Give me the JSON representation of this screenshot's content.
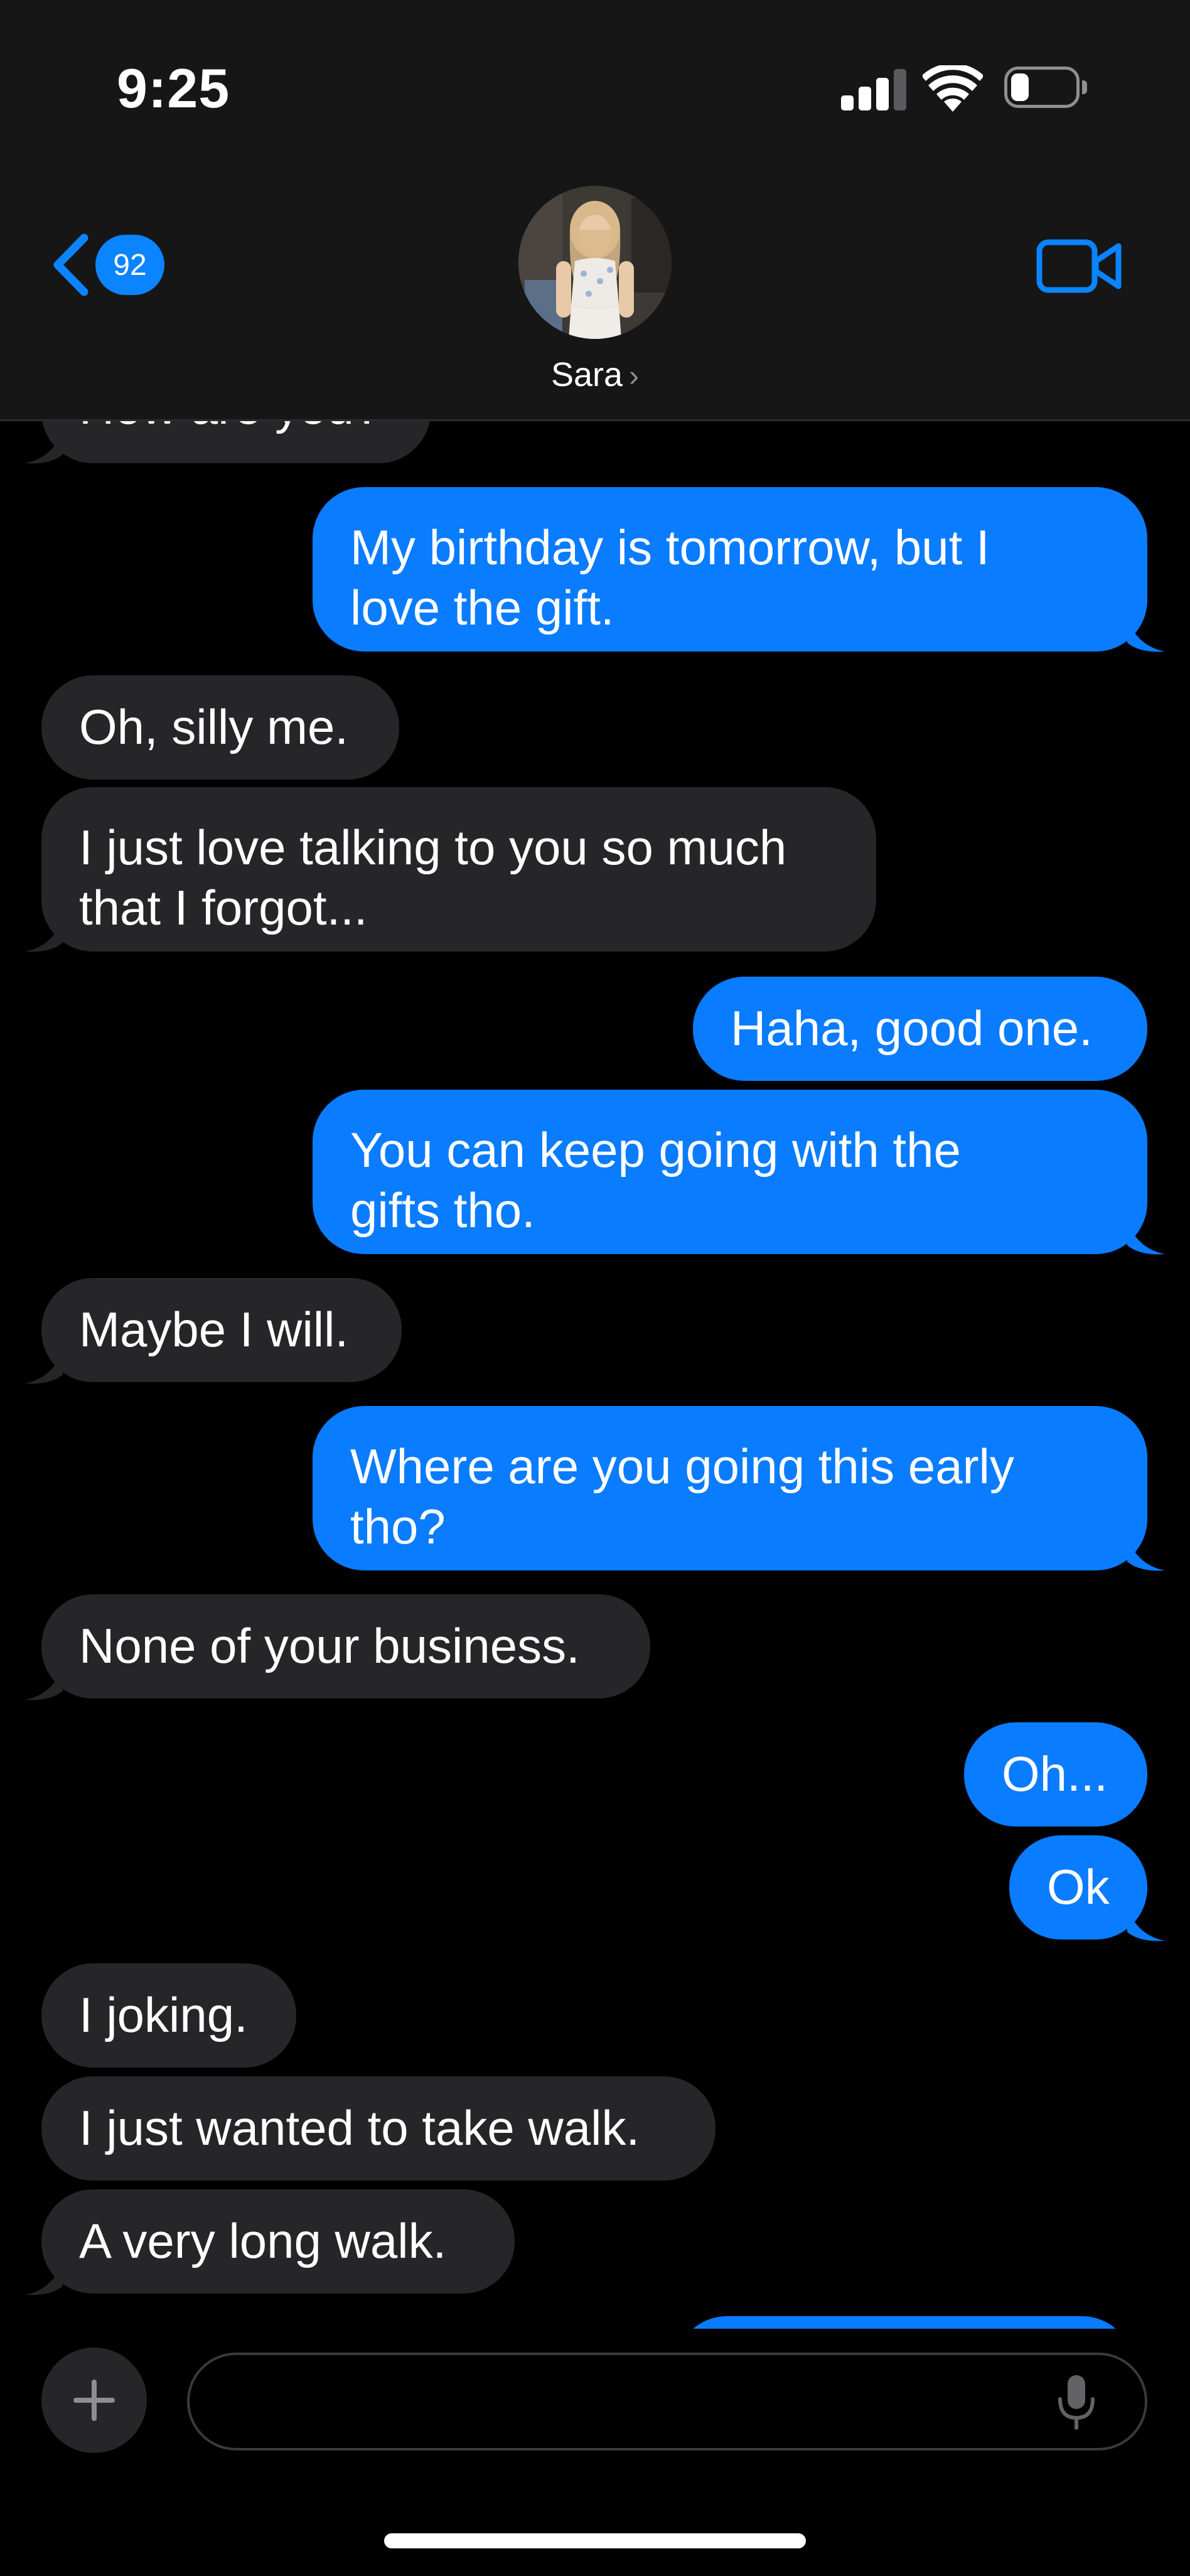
{
  "status_bar": {
    "time": "9:25",
    "icons": [
      "signal-icon",
      "wifi-icon",
      "battery-icon"
    ],
    "battery_level": 0.2
  },
  "header": {
    "back_badge": "92",
    "contact_name": "Sara",
    "chevron": "›",
    "icons": [
      "back-chevron-icon",
      "video-camera-icon"
    ]
  },
  "messages": [
    {
      "from": "them",
      "text": "How are you?"
    },
    {
      "from": "me",
      "text": "My birthday is tomorrow, but I\nlove the gift."
    },
    {
      "from": "them",
      "text": "Oh, silly me."
    },
    {
      "from": "them",
      "text": "I just love talking to you so much\nthat I forgot..."
    },
    {
      "from": "me",
      "text": "Haha, good one."
    },
    {
      "from": "me",
      "text": "You can keep going with the\ngifts tho."
    },
    {
      "from": "them",
      "text": "Maybe I will."
    },
    {
      "from": "me",
      "text": "Where are you going this early\ntho?"
    },
    {
      "from": "them",
      "text": "None of your business."
    },
    {
      "from": "me",
      "text": "Oh..."
    },
    {
      "from": "me",
      "text": "Ok"
    },
    {
      "from": "them",
      "text": "I joking."
    },
    {
      "from": "them",
      "text": "I just wanted to take walk."
    },
    {
      "from": "them",
      "text": "A very long walk."
    },
    {
      "from": "me",
      "text": ""
    }
  ],
  "input": {
    "placeholder": "",
    "value": "",
    "icons": [
      "plus-icon",
      "microphone-icon"
    ]
  },
  "colors": {
    "outgoing_bubble": "#0a7cff",
    "incoming_bubble": "#262628",
    "accent": "#0a84ff",
    "background": "#000000",
    "header": "#161616"
  }
}
